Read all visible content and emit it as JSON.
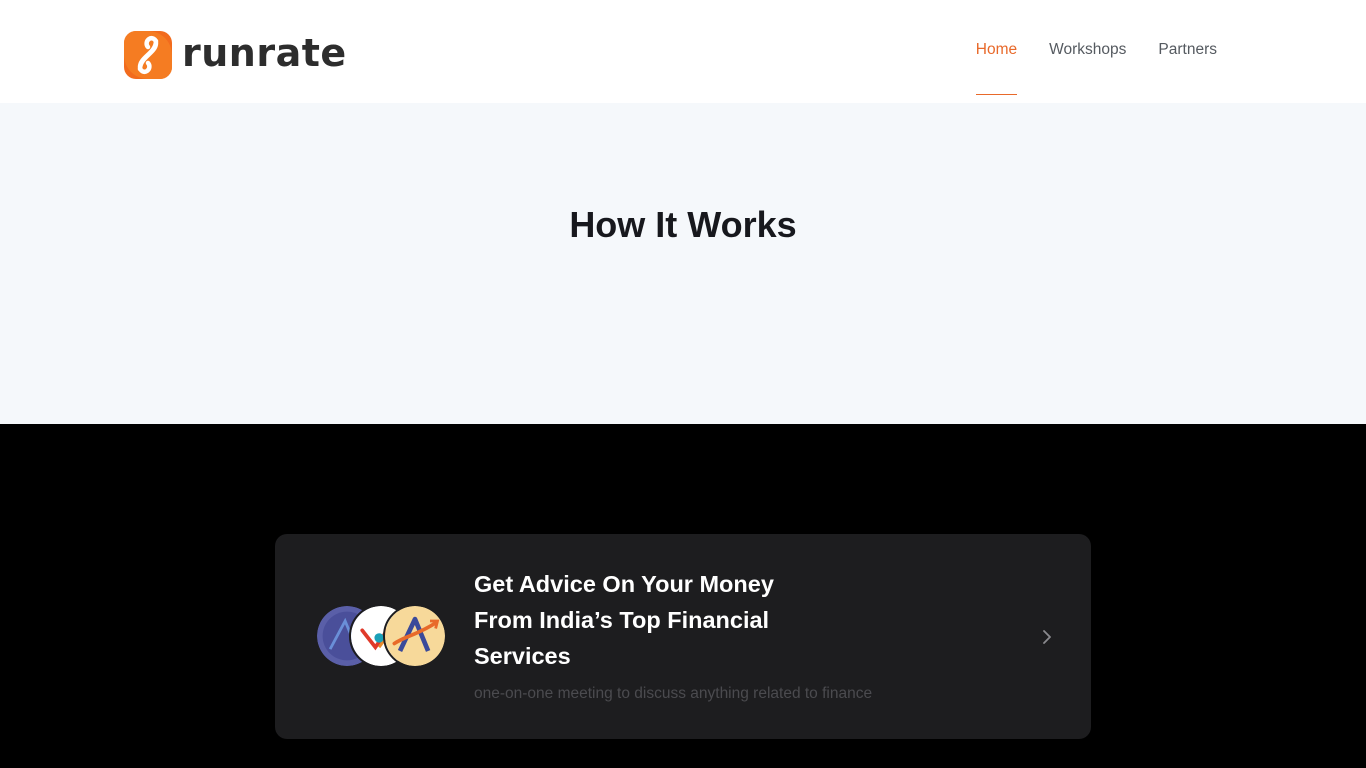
{
  "brand": {
    "name": "runrate",
    "accent_color": "#e8692a",
    "logo_icon": "runrate-logo-icon"
  },
  "nav": {
    "items": [
      {
        "label": "Home",
        "active": true
      },
      {
        "label": "Workshops",
        "active": false
      },
      {
        "label": "Partners",
        "active": false
      }
    ]
  },
  "hero": {
    "title": "How It Works",
    "background": "#f5f8fb"
  },
  "card": {
    "title": "Get Advice On Your Money From India’s Top Financial Services",
    "subtitle": "one-on-one meeting to discuss anything related to finance",
    "avatars": [
      {
        "icon": "advisor-logo-blue-icon",
        "color": "#5a5fa8"
      },
      {
        "icon": "advisor-logo-white-icon",
        "color": "#ffffff"
      },
      {
        "icon": "advisor-logo-yellow-icon",
        "color": "#f7d99a"
      }
    ],
    "action_icon": "chevron-right-icon"
  }
}
